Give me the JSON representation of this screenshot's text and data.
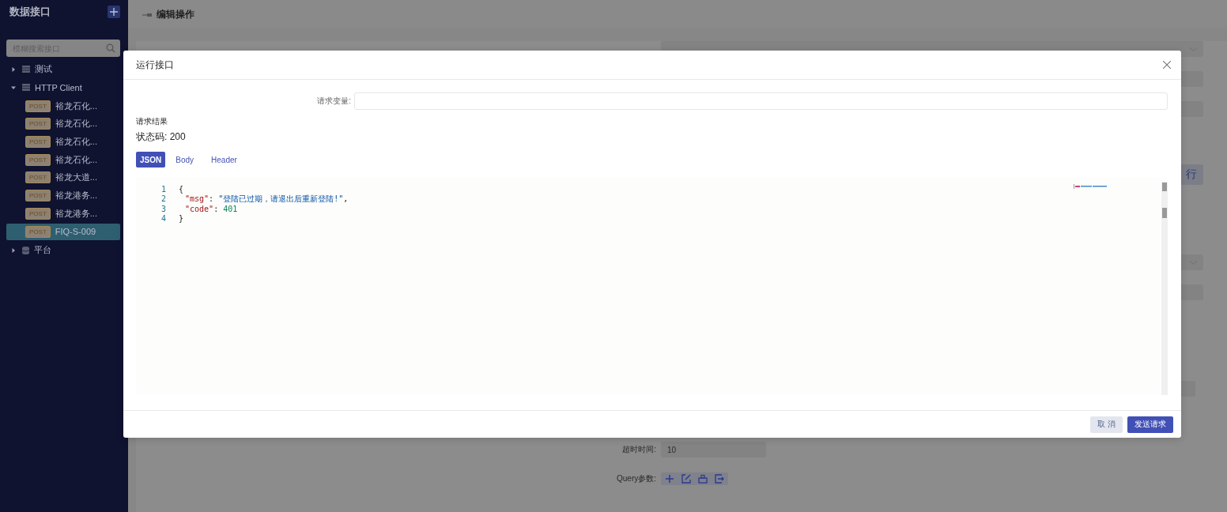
{
  "sidebar": {
    "title": "数据接口",
    "search": {
      "placeholder": "模糊搜索接口"
    },
    "tree": [
      {
        "label": "测试",
        "kind": "table",
        "expanded": false
      },
      {
        "label": "HTTP Client",
        "kind": "table",
        "expanded": true,
        "children": [
          {
            "method": "POST",
            "label": "裕龙石化...",
            "selected": false
          },
          {
            "method": "POST",
            "label": "裕龙石化...",
            "selected": false
          },
          {
            "method": "POST",
            "label": "裕龙石化...",
            "selected": false
          },
          {
            "method": "POST",
            "label": "裕龙石化...",
            "selected": false
          },
          {
            "method": "POST",
            "label": "裕龙大道...",
            "selected": false
          },
          {
            "method": "POST",
            "label": "裕龙港务...",
            "selected": false
          },
          {
            "method": "POST",
            "label": "裕龙港务...",
            "selected": false
          },
          {
            "method": "POST",
            "label": "FIQ-S-009",
            "selected": true
          }
        ]
      },
      {
        "label": "平台",
        "kind": "database",
        "expanded": false
      }
    ]
  },
  "header": {
    "title": "编辑操作"
  },
  "form": {
    "rows": [
      {
        "kind": "select"
      },
      {
        "kind": "input"
      },
      {
        "kind": "input"
      },
      {
        "kind": "button",
        "label": "行"
      },
      {
        "kind": "select"
      },
      {
        "kind": "input"
      },
      {
        "kind": "input"
      },
      {
        "kind": "input",
        "label": "超时时间:",
        "value": "10"
      },
      {
        "kind": "tools",
        "label": "Query参数:"
      }
    ]
  },
  "dialog": {
    "title": "运行接口",
    "variables": {
      "label": "请求变量:"
    },
    "result_title": "请求结果",
    "status": "状态码: 200",
    "tabs": [
      {
        "label": "JSON",
        "selected": true
      },
      {
        "label": "Body",
        "selected": false
      },
      {
        "label": "Header",
        "selected": false
      }
    ],
    "code": [
      {
        "number": "1",
        "kind": "brace",
        "tokens": [
          {
            "kind": "punct",
            "text": "{"
          }
        ]
      },
      {
        "number": "2",
        "kind": "member",
        "tokens": [
          {
            "kind": "key",
            "text": "\"msg\""
          },
          {
            "kind": "punct",
            "text": ": "
          },
          {
            "kind": "string",
            "text": "\"登陆已过期，请退出后重新登陆!\""
          },
          {
            "kind": "punct",
            "text": ","
          }
        ]
      },
      {
        "number": "3",
        "kind": "member",
        "tokens": [
          {
            "kind": "key",
            "text": "\"code\""
          },
          {
            "kind": "punct",
            "text": ": "
          },
          {
            "kind": "number",
            "text": "401"
          }
        ]
      },
      {
        "number": "4",
        "kind": "brace",
        "tokens": [
          {
            "kind": "punct",
            "text": "}"
          }
        ]
      }
    ],
    "buttons": [
      {
        "label": "取 消",
        "kind": "secondary"
      },
      {
        "label": "发送请求",
        "kind": "primary"
      }
    ]
  }
}
